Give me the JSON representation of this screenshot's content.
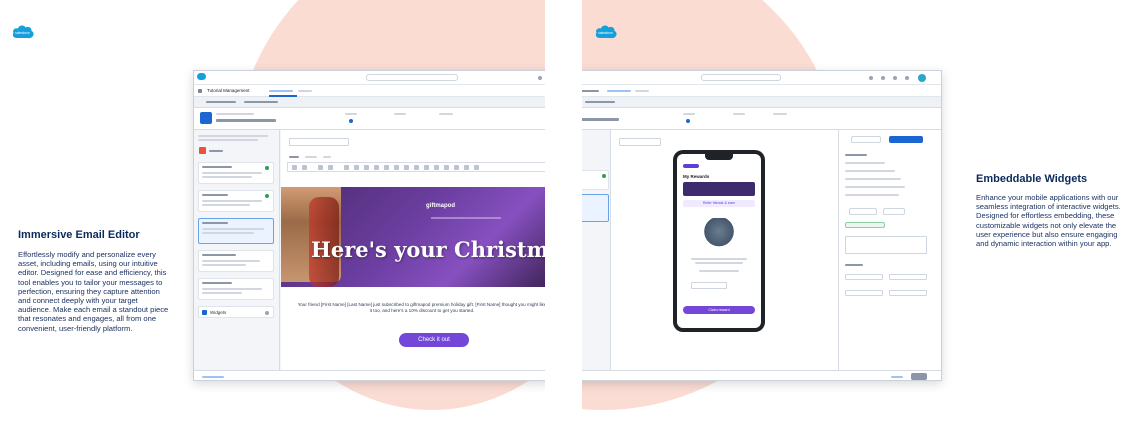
{
  "left": {
    "heading": "Immersive Email Editor",
    "body": "Effortlessly modify and personalize every asset, including emails, using our intuitive editor. Designed for ease and efficiency, this tool enables you to tailor your messages to perfection, ensuring they capture attention and connect deeply with your target audience. Make each email a standout piece that resonates and engages, all from one convenient, user-friendly platform.",
    "app": {
      "nav_title": "Tutorial Management",
      "banner_headline": "Here's your Christmas Surpr",
      "banner_brand": "giftmapod",
      "cta_label": "Check it out",
      "promo_text": "Your friend [First Name] [Last Name] just subscribed to giftmapod premium holiday gift. [First Name] thought you might like it too, and here's a 10% discount to get you started.",
      "sidebar_bottom_label": "Widgets"
    }
  },
  "right": {
    "heading": "Embeddable Widgets",
    "body": "Enhance your mobile applications with our seamless integration of interactive widgets. Designed for effortless embedding, these customizable widgets not only elevate the user experience but also ensure engaging and dynamic interaction within your app.",
    "app": {
      "phone_header": "My Rewards",
      "phone_button": "Refer friends & earn",
      "phone_cta": "Claim reward"
    }
  },
  "colors": {
    "blob": "#fadcd3",
    "brand_blue": "#16a0db",
    "heading": "#0b2a5c",
    "accent_purple": "#7547d8"
  }
}
